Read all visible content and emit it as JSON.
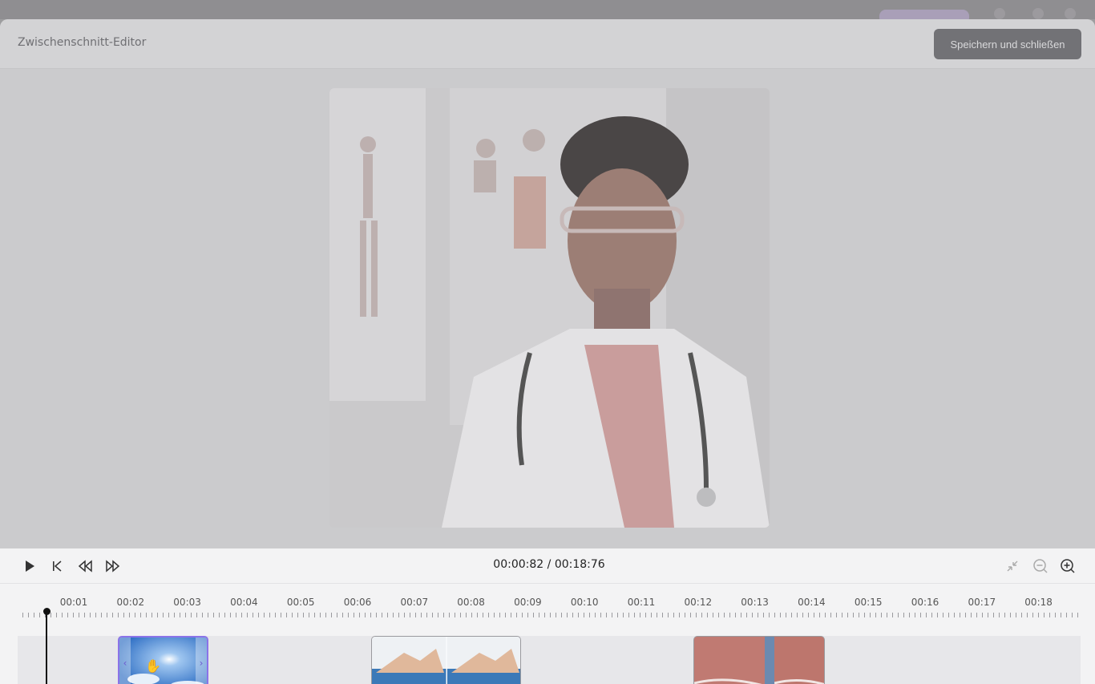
{
  "modal": {
    "title": "Zwischenschnitt-Editor",
    "save_label": "Speichern und schließen"
  },
  "player": {
    "current_time": "00:00:82",
    "total_time": "00:18:76",
    "separator": " / "
  },
  "timeline": {
    "tick_labels": [
      "00:01",
      "00:02",
      "00:03",
      "00:04",
      "00:05",
      "00:06",
      "00:07",
      "00:08",
      "00:09",
      "00:10",
      "00:11",
      "00:12",
      "00:13",
      "00:14",
      "00:15",
      "00:16",
      "00:17",
      "00:18"
    ],
    "clips": [
      {
        "name": "clip-sky",
        "selected": true
      },
      {
        "name": "clip-beach",
        "selected": false
      },
      {
        "name": "clip-closeup",
        "selected": false
      }
    ]
  },
  "colors": {
    "accent": "#8b73e8",
    "save_button": "#727276"
  },
  "icons": [
    "play-icon",
    "skip-start-icon",
    "rewind-icon",
    "fast-forward-icon",
    "collapse-icon",
    "zoom-out-icon",
    "zoom-in-icon"
  ]
}
